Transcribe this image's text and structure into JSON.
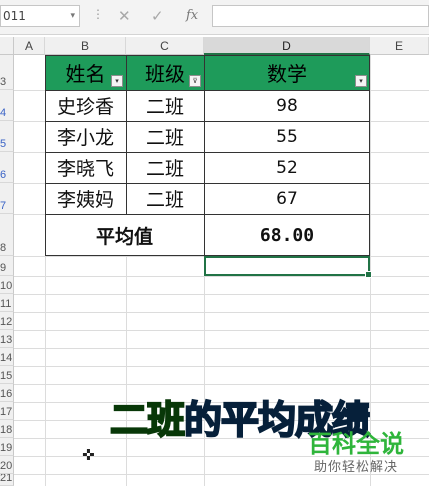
{
  "formula_bar": {
    "name_box": "011",
    "cancel_glyph": "✕",
    "enter_glyph": "✓",
    "fx_label": "fx",
    "formula": ""
  },
  "columns": [
    "A",
    "B",
    "C",
    "D",
    "E"
  ],
  "rows": [
    "3",
    "4",
    "5",
    "6",
    "7",
    "8",
    "9",
    "10",
    "11",
    "12",
    "13",
    "14",
    "15",
    "16",
    "17",
    "18",
    "19",
    "20",
    "21"
  ],
  "table": {
    "headers": [
      "姓名",
      "班级",
      "数学"
    ],
    "rows": [
      [
        "史珍香",
        "二班",
        "98"
      ],
      [
        "李小龙",
        "二班",
        "55"
      ],
      [
        "李晓飞",
        "二班",
        "52"
      ],
      [
        "李姨妈",
        "二班",
        "67"
      ]
    ],
    "summary_label": "平均值",
    "summary_value": "68.00",
    "filter_glyph": "▾",
    "filter_active_glyph": "⊽"
  },
  "caption": {
    "part1": "二班",
    "part2": "的平均成绩"
  },
  "watermark": {
    "main": "百科全说",
    "sub": "助你轻松解决"
  },
  "colors": {
    "header_green": "#1e9b5a",
    "selection_green": "#217346"
  },
  "icons": {
    "cursor": "cross-cursor-icon"
  }
}
